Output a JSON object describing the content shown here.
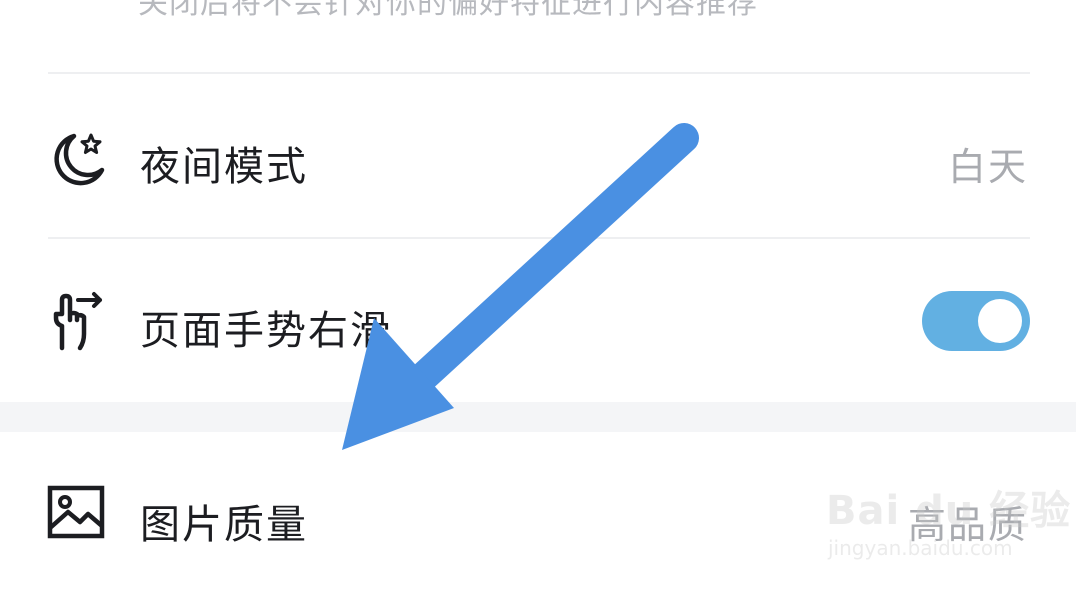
{
  "settings": {
    "top_description": "关闭后将不会针对你的偏好特征进行内容推荐",
    "items": [
      {
        "label": "夜间模式",
        "value": "白天",
        "icon": "moon-star-icon"
      },
      {
        "label": "页面手势右滑",
        "toggle_on": true,
        "icon": "swipe-gesture-icon"
      },
      {
        "label": "图片质量",
        "value": "高品质",
        "icon": "image-icon"
      }
    ]
  },
  "annotation": {
    "arrow_color": "#4a90e2"
  },
  "watermark": {
    "brand": "Bai du 经验",
    "url": "jingyan.baidu.com"
  },
  "colors": {
    "toggle_on": "#62b0e2",
    "text": "#1c1d21",
    "secondary_text": "#a9abb0"
  }
}
